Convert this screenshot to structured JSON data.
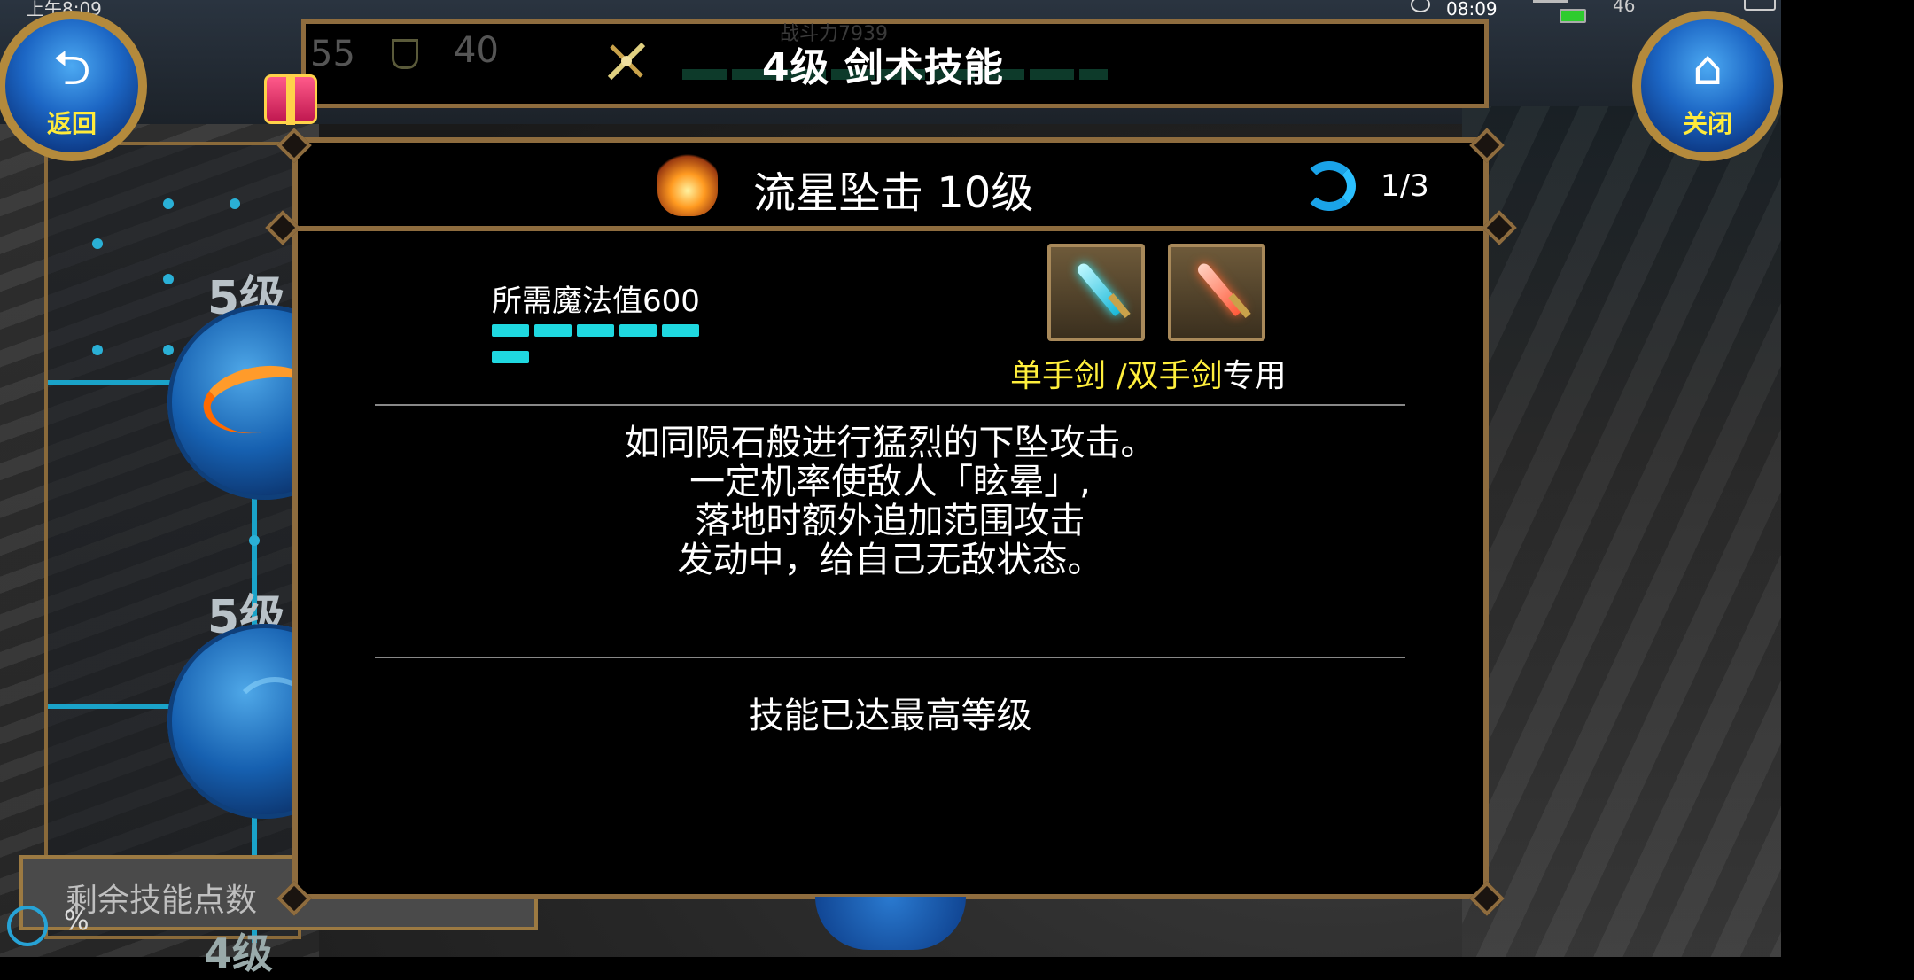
{
  "status_bar": {
    "time_left": "上午8:09",
    "time_center": "08:09",
    "right_info": "46"
  },
  "header": {
    "mp_value": "55",
    "hp_value": "40",
    "faded_label": "战斗力7939",
    "title": "4级 剑术技能"
  },
  "buttons": {
    "back": "返回",
    "close": "关闭"
  },
  "left_panel": {
    "level_labels": [
      "5级",
      "5级"
    ],
    "remaining_points_label": "剩余技能点数",
    "percent_label": "%",
    "bottom_level": "4级"
  },
  "skill": {
    "name": "流星坠击 10级",
    "page": "1/3",
    "mp_required": "所需魔法值600",
    "mp_bar_count": 6,
    "weapon_1": "单手剑",
    "weapon_sep": " /",
    "weapon_2": "双手剑",
    "weapon_suffix": "专用",
    "description": [
      "如同陨石般进行猛烈的下坠攻击。",
      "一定机率使敌人「眩晕」,",
      "落地时额外追加范围攻击",
      "发动中，给自己无敌状态。"
    ],
    "max_level_text": "技能已达最高等级"
  },
  "colors": {
    "frame_gold": "#8e6c3e",
    "mp_bar_cyan": "#1fd8e0",
    "weapon_yellow": "#ffef3c",
    "button_blue": "#1c66c4"
  },
  "icons": {
    "back": "return-arrow-icon",
    "close": "home-icon",
    "skill": "meteor-fire-icon",
    "refresh": "refresh-icon",
    "weapon_1": "one-handed-sword-icon",
    "weapon_2": "two-handed-sword-icon",
    "gift": "gift-box-icon"
  }
}
